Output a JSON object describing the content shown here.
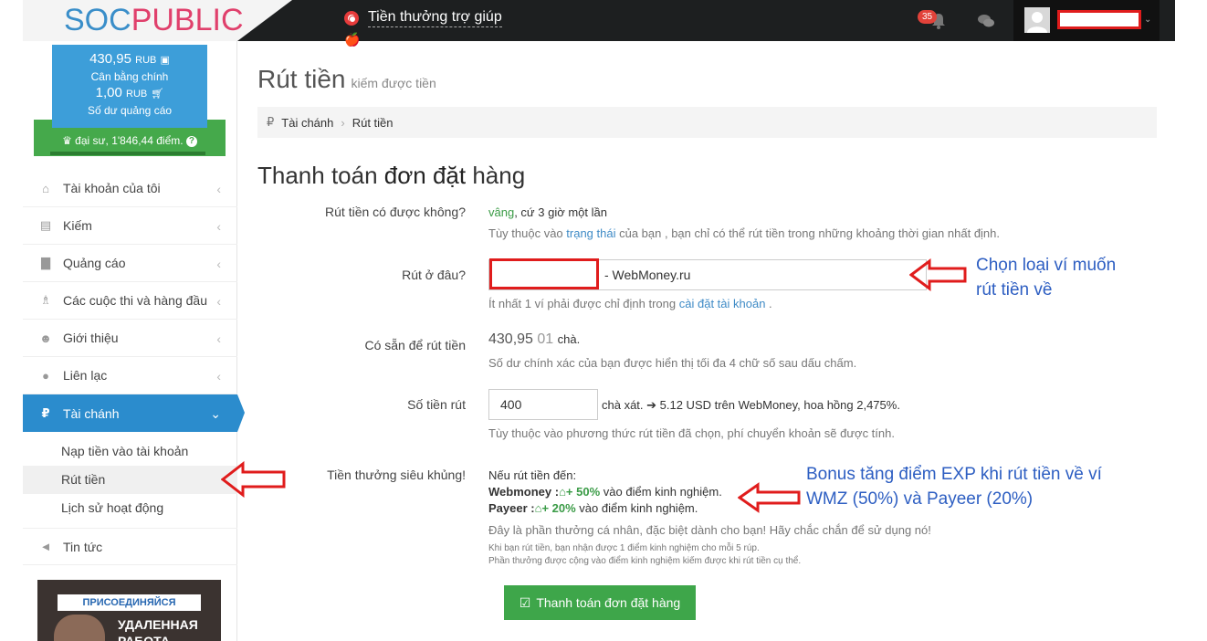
{
  "header": {
    "logo_soc": "SOC",
    "logo_pub": "PUBLIC",
    "help_text": "Tiền thưởng trợ giúp",
    "notif_count": "35"
  },
  "sidebar": {
    "main_balance": "430,95",
    "main_currency": "RUB",
    "main_balance_label": "Cân bằng chính",
    "ad_balance": "1,00",
    "ad_currency": "RUB",
    "ad_balance_label": "Số dư quảng cáo",
    "rank_text": "đại sư, 1'846,44 điểm.",
    "rank_help": "?",
    "items": [
      {
        "label": "Tài khoản của tôi"
      },
      {
        "label": "Kiếm"
      },
      {
        "label": "Quảng cáo"
      },
      {
        "label": "Các cuộc thi và hàng đầu"
      },
      {
        "label": "Giới thiệu"
      },
      {
        "label": "Liên lạc"
      },
      {
        "label": "Tài chánh"
      }
    ],
    "sub_items": [
      {
        "label": "Nạp tiền vào tài khoản"
      },
      {
        "label": "Rút tiền"
      },
      {
        "label": "Lịch sử hoạt động"
      }
    ],
    "news": "Tin tức",
    "promo_top": "ПРИСОЕДИНЯЙСЯ",
    "promo_line1": "УДАЛЕННАЯ",
    "promo_line2": "РАБОТА"
  },
  "main": {
    "title": "Rút tiền",
    "subtitle": "kiếm được tiền",
    "breadcrumb": [
      "Tài chánh",
      "Rút tiền"
    ],
    "section_title_a": "Thanh toán ",
    "section_title_b": "đơn đặt",
    "section_title_c": " hàng",
    "can_withdraw_label": "Rút tiền có được không?",
    "can_withdraw_yes": "vâng",
    "can_withdraw_value": ", cứ 3 giờ một lần",
    "can_withdraw_hint_a": "Tùy thuộc vào ",
    "can_withdraw_hint_link": "trạng thái",
    "can_withdraw_hint_b": " của bạn , bạn chỉ có thể rút tiền trong những khoảng thời gian nhất định.",
    "where_label": "Rút ở đâu?",
    "wallet_name": "- WebMoney.ru",
    "where_hint_a": "Ít nhất 1 ví phải được chỉ định trong ",
    "where_hint_link": "cài đặt tài khoản",
    "where_hint_b": " .",
    "available_label": "Có sẵn để rút tiền",
    "available_value": "430,95",
    "available_decimals": "01",
    "available_unit": "chà.",
    "available_hint": "Số dư chính xác của bạn được hiển thị tối đa 4 chữ số sau dấu chấm.",
    "amount_label": "Số tiền rút",
    "amount_value": "400",
    "amount_calc": "chà xát. ➔ 5.12 USD trên WebMoney, hoa hồng 2,475%.",
    "amount_hint": "Tùy thuộc vào phương thức rút tiền đã chọn, phí chuyển khoản sẽ được tính.",
    "bonus_label": "Tiền thưởng siêu khủng!",
    "bonus_intro": "Nếu rút tiền đến:",
    "bonus_webmoney_name": "Webmoney :",
    "bonus_webmoney_pct": "+ 50%",
    "bonus_webmoney_tail": " vào điểm kinh nghiệm.",
    "bonus_payeer_name": "Payeer :",
    "bonus_payeer_pct": "+ 20%",
    "bonus_payeer_tail": " vào điểm kinh nghiệm.",
    "bonus_note": "Đây là phần thưởng cá nhân, đặc biệt dành cho bạn! Hãy chắc chắn để sử dụng nó!",
    "bonus_tiny1": "Khi bạn rút tiền, bạn nhận được 1 điểm kinh nghiệm cho mỗi 5 rúp.",
    "bonus_tiny2": "Phần thưởng được cộng vào điểm kinh nghiệm kiếm được khi rút tiền cụ thể.",
    "submit_label": "Thanh toán đơn đặt hàng"
  },
  "annotations": {
    "wallet_note_1": "Chọn loại ví muốn",
    "wallet_note_2": "rút tiền về",
    "bonus_note_1": "Bonus tăng điểm EXP khi rút tiền về ví",
    "bonus_note_2": "WMZ (50%) và Payeer (20%)"
  },
  "colors": {
    "accent_blue": "#2b8ccd",
    "balance_blue": "#3d9ed9",
    "success_green": "#3ea64a",
    "annotation_red": "#e01c1c",
    "annotation_blue": "#2d5ec2"
  }
}
